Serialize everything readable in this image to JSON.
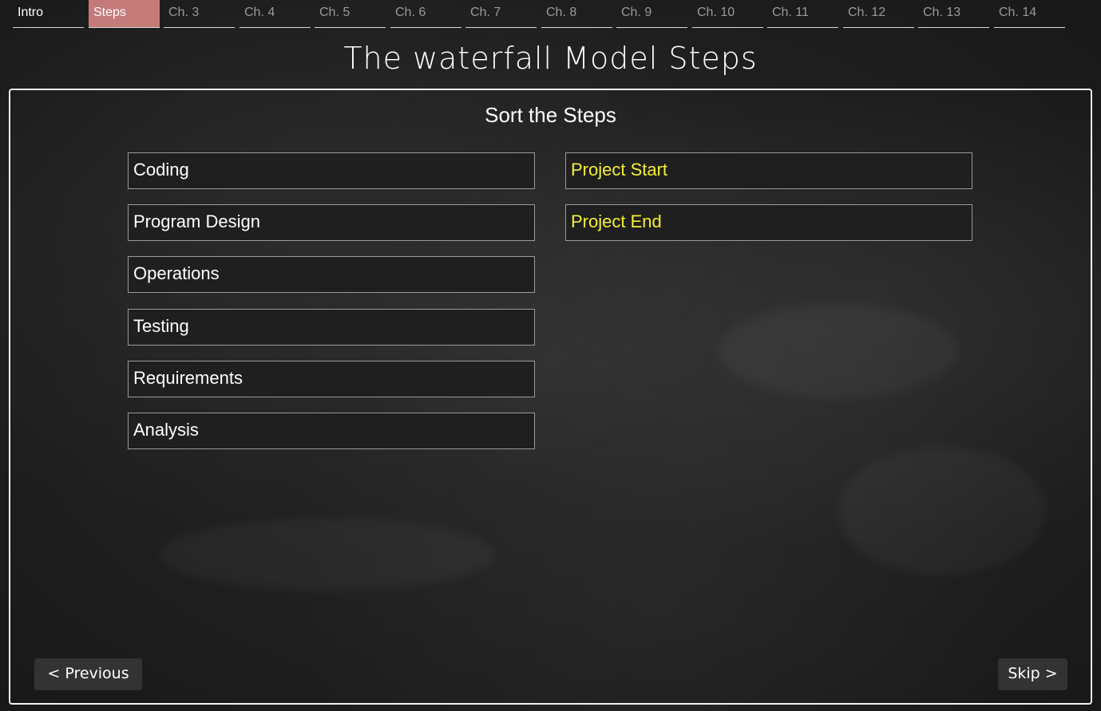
{
  "chapters": [
    {
      "label": "Intro"
    },
    {
      "label": "Steps"
    },
    {
      "label": "Ch. 3"
    },
    {
      "label": "Ch. 4"
    },
    {
      "label": "Ch. 5"
    },
    {
      "label": "Ch. 6"
    },
    {
      "label": "Ch. 7"
    },
    {
      "label": "Ch. 8"
    },
    {
      "label": "Ch. 9"
    },
    {
      "label": "Ch. 10"
    },
    {
      "label": "Ch. 11"
    },
    {
      "label": "Ch. 12"
    },
    {
      "label": "Ch. 13"
    },
    {
      "label": "Ch. 14"
    }
  ],
  "active_chapter": "Steps",
  "title": "The waterfall Model Steps",
  "panel": {
    "heading": "Sort the Steps",
    "steps": [
      {
        "label": "Coding"
      },
      {
        "label": "Program Design"
      },
      {
        "label": "Operations"
      },
      {
        "label": "Testing"
      },
      {
        "label": "Requirements"
      },
      {
        "label": "Analysis"
      }
    ],
    "targets": [
      {
        "label": "Project Start"
      },
      {
        "label": "Project End"
      }
    ]
  },
  "nav": {
    "previous_label": "< Previous",
    "skip_label": "Skip >"
  },
  "colors": {
    "background": "#1f1f1f",
    "active_tab": "#c57a7a",
    "target_text": "#f5f030",
    "item_border": "#9a9a9a",
    "button_bg": "#333333"
  }
}
